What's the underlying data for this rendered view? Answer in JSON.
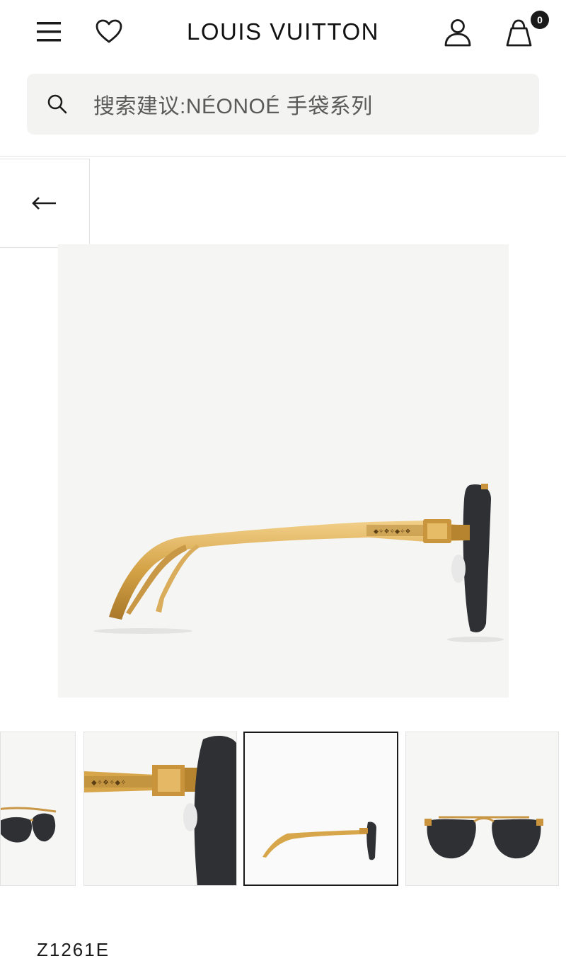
{
  "header": {
    "brand": "LOUIS VUITTON",
    "bag_count": "0",
    "icons": [
      "menu-icon",
      "heart-icon",
      "account-icon",
      "shopping-bag-icon"
    ]
  },
  "search": {
    "placeholder": "搜索建议:NÉONOÉ 手袋系列",
    "icon": "search-icon"
  },
  "navigation": {
    "back_icon": "left-arrow-icon"
  },
  "gallery": {
    "thumbnails": [
      {
        "view": "front-angle",
        "active": false
      },
      {
        "view": "hinge-detail",
        "active": false
      },
      {
        "view": "side-profile",
        "active": true
      },
      {
        "view": "front",
        "active": false
      }
    ]
  },
  "product": {
    "sku": "Z1261E"
  },
  "colors": {
    "gold": "#d7a64a",
    "lens": "#2f3034",
    "text": "#1a1a1a",
    "search_bg": "#f3f3f1"
  }
}
